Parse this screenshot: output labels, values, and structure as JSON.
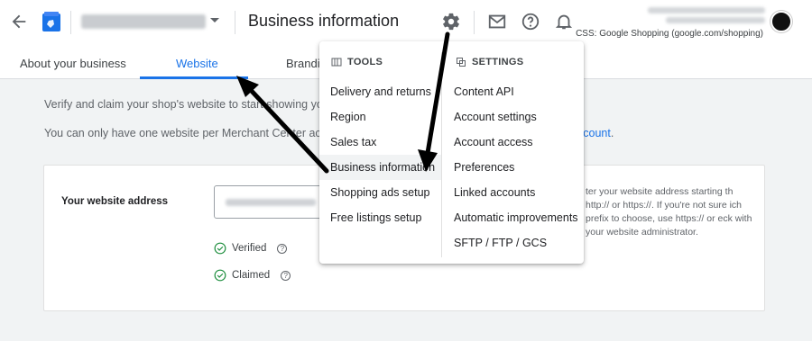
{
  "header": {
    "page_title": "Business information",
    "css_label": "CSS: Google Shopping (google.com/shopping)"
  },
  "tabs": [
    {
      "label": "About your business",
      "active": false
    },
    {
      "label": "Website",
      "active": true
    },
    {
      "label": "Brandi",
      "active": false
    }
  ],
  "content": {
    "para1": "Verify and claim your shop's website to start showing your",
    "para2a": "You can only have one website per Merchant Center accou",
    "para2_link": "ccount",
    "para2_tail": "."
  },
  "card": {
    "field_label": "Your website address",
    "hint": "ter your website address starting th http:// or https://. If you're not sure ich prefix to choose, use https:// or eck with your website administrator.",
    "verified_label": "Verified",
    "claimed_label": "Claimed"
  },
  "menu": {
    "tools_heading": "TOOLS",
    "settings_heading": "SETTINGS",
    "tools": [
      "Delivery and returns",
      "Region",
      "Sales tax",
      "Business information",
      "Shopping ads setup",
      "Free listings setup"
    ],
    "settings": [
      "Content API",
      "Account settings",
      "Account access",
      "Preferences",
      "Linked accounts",
      "Automatic improvements",
      "SFTP / FTP / GCS"
    ],
    "highlighted_tool": "Business information"
  },
  "colors": {
    "accent": "#1a73e8",
    "success": "#1e8e3e"
  },
  "icons": [
    "back-arrow-icon",
    "merchant-center-logo",
    "gear-icon",
    "mail-icon",
    "help-icon",
    "bell-icon",
    "check-circle-icon",
    "help-circle-icon",
    "tools-icon",
    "settings-icon"
  ]
}
